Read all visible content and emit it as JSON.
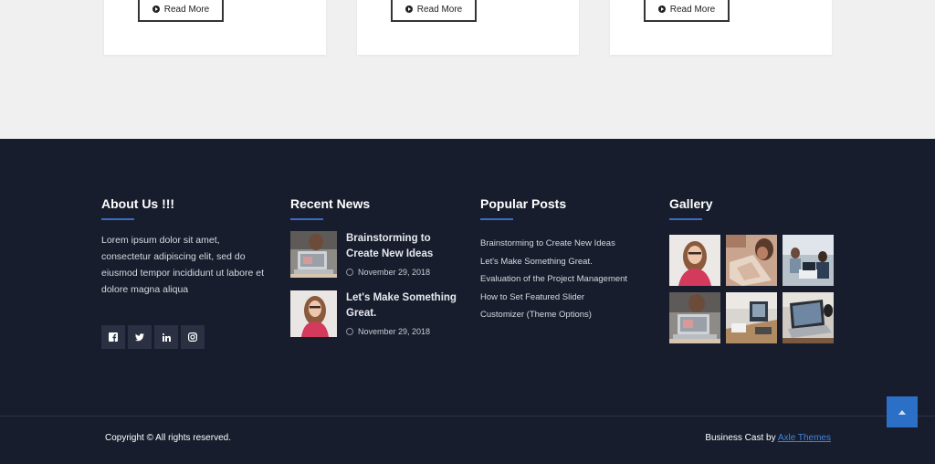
{
  "cards": [
    {
      "read_more": "Read More"
    },
    {
      "read_more": "Read More"
    },
    {
      "read_more": "Read More"
    }
  ],
  "about": {
    "title": "About Us !!!",
    "text": "Lorem ipsum dolor sit amet, consectetur adipiscing elit, sed do eiusmod tempor incididunt ut labore et dolore magna aliqua",
    "social": [
      "facebook-icon",
      "twitter-icon",
      "linkedin-icon",
      "instagram-icon"
    ]
  },
  "recent_news": {
    "title": "Recent News",
    "items": [
      {
        "title": "Brainstorming to Create New Ideas",
        "date": "November 29, 2018"
      },
      {
        "title": "Let's Make Something Great.",
        "date": "November 29, 2018"
      }
    ]
  },
  "popular_posts": {
    "title": "Popular Posts",
    "items": [
      "Brainstorming to Create New Ideas",
      "Let's Make Something Great.",
      "Evaluation of the Project Management",
      "How to Set Featured Slider",
      "Customizer (Theme Options)"
    ]
  },
  "gallery": {
    "title": "Gallery"
  },
  "bottom": {
    "copyright": "Copyright © All rights reserved.",
    "credit_prefix": "Business Cast by ",
    "credit_link": "Axle Themes"
  },
  "colors": {
    "footer_bg": "#181d2d",
    "accent": "#2c6fc7",
    "link": "#3a86e0"
  }
}
